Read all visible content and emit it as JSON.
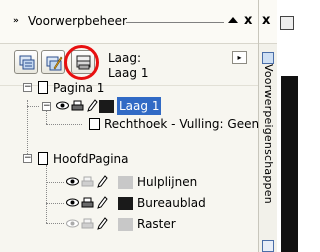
{
  "docker": {
    "title": "Voorwerpbeheer",
    "chevron": "»",
    "close_glyph": "x",
    "close_glyph_2": "x"
  },
  "toolbar": {
    "current_layer_line1": "Laag:",
    "current_layer_line2": "Laag 1",
    "small_button_glyph": "▸"
  },
  "tree": {
    "pages": [
      {
        "name": "Pagina 1",
        "expander": "−",
        "layers": [
          {
            "name": "Laag 1",
            "selected": true,
            "color": "#1a1a1a",
            "expander": "−",
            "objects": [
              {
                "name": "Rechthoek - Vulling: Geen"
              }
            ]
          }
        ]
      },
      {
        "name": "HoofdPagina",
        "expander": "−",
        "layers": [
          {
            "name": "Hulplijnen",
            "color": "#c8c8c8"
          },
          {
            "name": "Bureaublad",
            "color": "#1a1a1a"
          },
          {
            "name": "Raster",
            "color": "#c8c8c8"
          }
        ]
      }
    ]
  },
  "side_tabs": {
    "object_properties": "Voorwerpeigenschappen"
  },
  "colors": {
    "selection": "#316ac5",
    "highlight_ring": "#e81010"
  }
}
